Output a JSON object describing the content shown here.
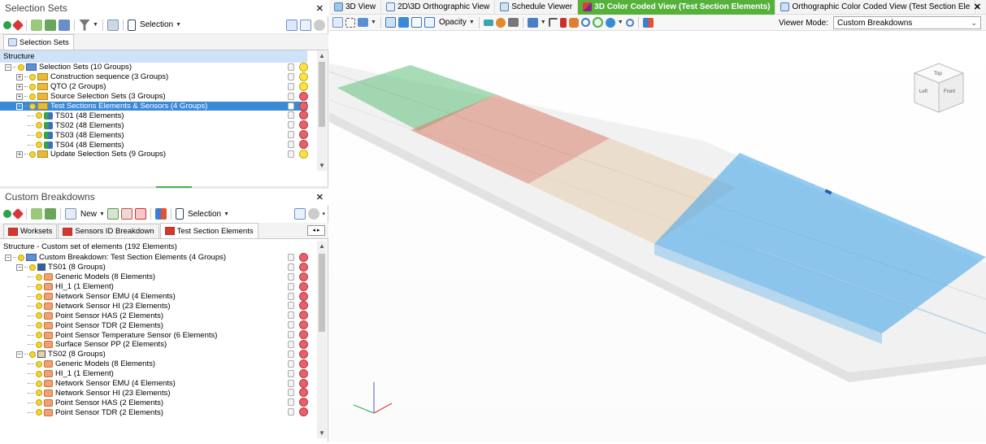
{
  "selection_sets": {
    "title": "Selection Sets",
    "toolbar": {
      "selection_label": "Selection"
    },
    "tab": "Selection Sets",
    "column_header": "Structure",
    "rows": [
      {
        "label": "Selection Sets (10 Groups)",
        "vis": "y"
      },
      {
        "label": "Construction sequence (3 Groups)",
        "vis": "y"
      },
      {
        "label": "QTO (2 Groups)",
        "vis": "y"
      },
      {
        "label": "Source Selection Sets (3 Groups)",
        "vis": "r"
      },
      {
        "label": "Test Sections Elements & Sensors (4 Groups)",
        "vis": "r"
      },
      {
        "label": "TS01 (48 Elements)",
        "vis": "r"
      },
      {
        "label": "TS02 (48 Elements)",
        "vis": "r"
      },
      {
        "label": "TS03 (48 Elements)",
        "vis": "r"
      },
      {
        "label": "TS04 (48 Elements)",
        "vis": "r"
      },
      {
        "label": "Update Selection Sets (9 Groups)",
        "vis": "y"
      }
    ]
  },
  "custom_breakdowns": {
    "title": "Custom Breakdowns",
    "toolbar": {
      "new_label": "New",
      "selection_label": "Selection"
    },
    "tabs": [
      "Worksets",
      "Sensors ID Breakdown",
      "Test Section Elements"
    ],
    "column_header": "Structure - Custom set of elements (192 Elements)",
    "rows": [
      {
        "label": "Custom Breakdown: Test Section Elements (4 Groups)"
      },
      {
        "label": "TS01 (8 Groups)"
      },
      {
        "label": "Generic Models (8 Elements)"
      },
      {
        "label": "HI_1 (1 Element)"
      },
      {
        "label": "Network Sensor EMU (4 Elements)"
      },
      {
        "label": "Network Sensor HI (23 Elements)"
      },
      {
        "label": "Point Sensor HAS (2 Elements)"
      },
      {
        "label": "Point Sensor TDR (2 Elements)"
      },
      {
        "label": "Point Sensor Temperature Sensor (6 Elements)"
      },
      {
        "label": "Surface Sensor PP (2 Elements)"
      },
      {
        "label": "TS02 (8 Groups)"
      },
      {
        "label": "Generic Models (8 Elements)"
      },
      {
        "label": "HI_1 (1 Element)"
      },
      {
        "label": "Network Sensor EMU (4 Elements)"
      },
      {
        "label": "Network Sensor HI (23 Elements)"
      },
      {
        "label": "Point Sensor HAS (2 Elements)"
      },
      {
        "label": "Point Sensor TDR (2 Elements)"
      }
    ]
  },
  "view": {
    "tabs": [
      "3D View",
      "2D\\3D Orthographic View",
      "Schedule Viewer",
      "3D Color Coded View (Test Section Elements)",
      "Orthographic Color Coded View (Test Section Ele"
    ],
    "active_tab_color": "#55b13a",
    "toolbar": {
      "opacity_label": "Opacity",
      "viewer_mode_label": "Viewer Mode:",
      "viewer_mode_value": "Custom Breakdowns"
    },
    "cube": {
      "top": "Top",
      "left": "Left",
      "front": "Front"
    },
    "section_colors": [
      "#5fbf7a",
      "#d9806a",
      "#e3caa8",
      "#4aa8e8"
    ]
  }
}
